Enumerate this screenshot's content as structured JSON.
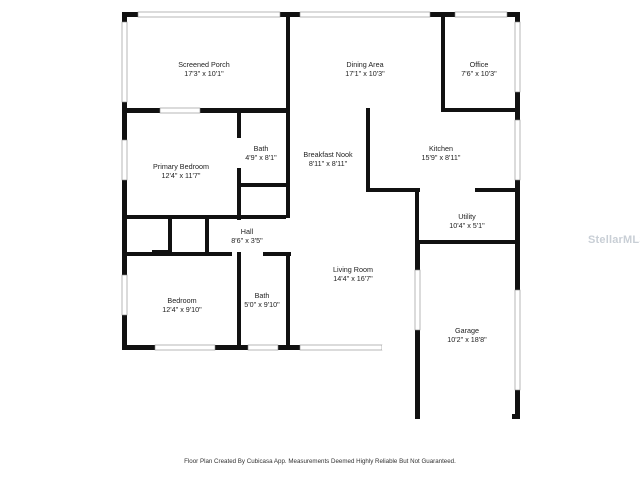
{
  "rooms": {
    "screened_porch": {
      "name": "Screened Porch",
      "dim": "17'3\" x 10'1\""
    },
    "dining_area": {
      "name": "Dining Area",
      "dim": "17'1\" x 10'3\""
    },
    "office": {
      "name": "Office",
      "dim": "7'6\" x 10'3\""
    },
    "bath_upper": {
      "name": "Bath",
      "dim": "4'9\" x 8'1\""
    },
    "breakfast_nook": {
      "name": "Breakfast Nook",
      "dim": "8'11\" x 8'11\""
    },
    "kitchen": {
      "name": "Kitchen",
      "dim": "15'9\" x 8'11\""
    },
    "primary_bedroom": {
      "name": "Primary Bedroom",
      "dim": "12'4\" x 11'7\""
    },
    "utility": {
      "name": "Utility",
      "dim": "10'4\" x 5'1\""
    },
    "hall": {
      "name": "Hall",
      "dim": "8'6\" x 3'5\""
    },
    "living_room": {
      "name": "Living Room",
      "dim": "14'4\" x 16'7\""
    },
    "bedroom": {
      "name": "Bedroom",
      "dim": "12'4\" x 9'10\""
    },
    "bath_lower": {
      "name": "Bath",
      "dim": "5'0\" x 9'10\""
    },
    "garage": {
      "name": "Garage",
      "dim": "10'2\" x 18'8\""
    }
  },
  "footer_note": "Floor Plan Created By Cubicasa App. Measurements Deemed Highly Reliable But Not Guaranteed.",
  "watermark": "StellarMLS",
  "colors": {
    "wall": "#111111",
    "background": "#ffffff",
    "watermark": "#c9cfd6"
  }
}
